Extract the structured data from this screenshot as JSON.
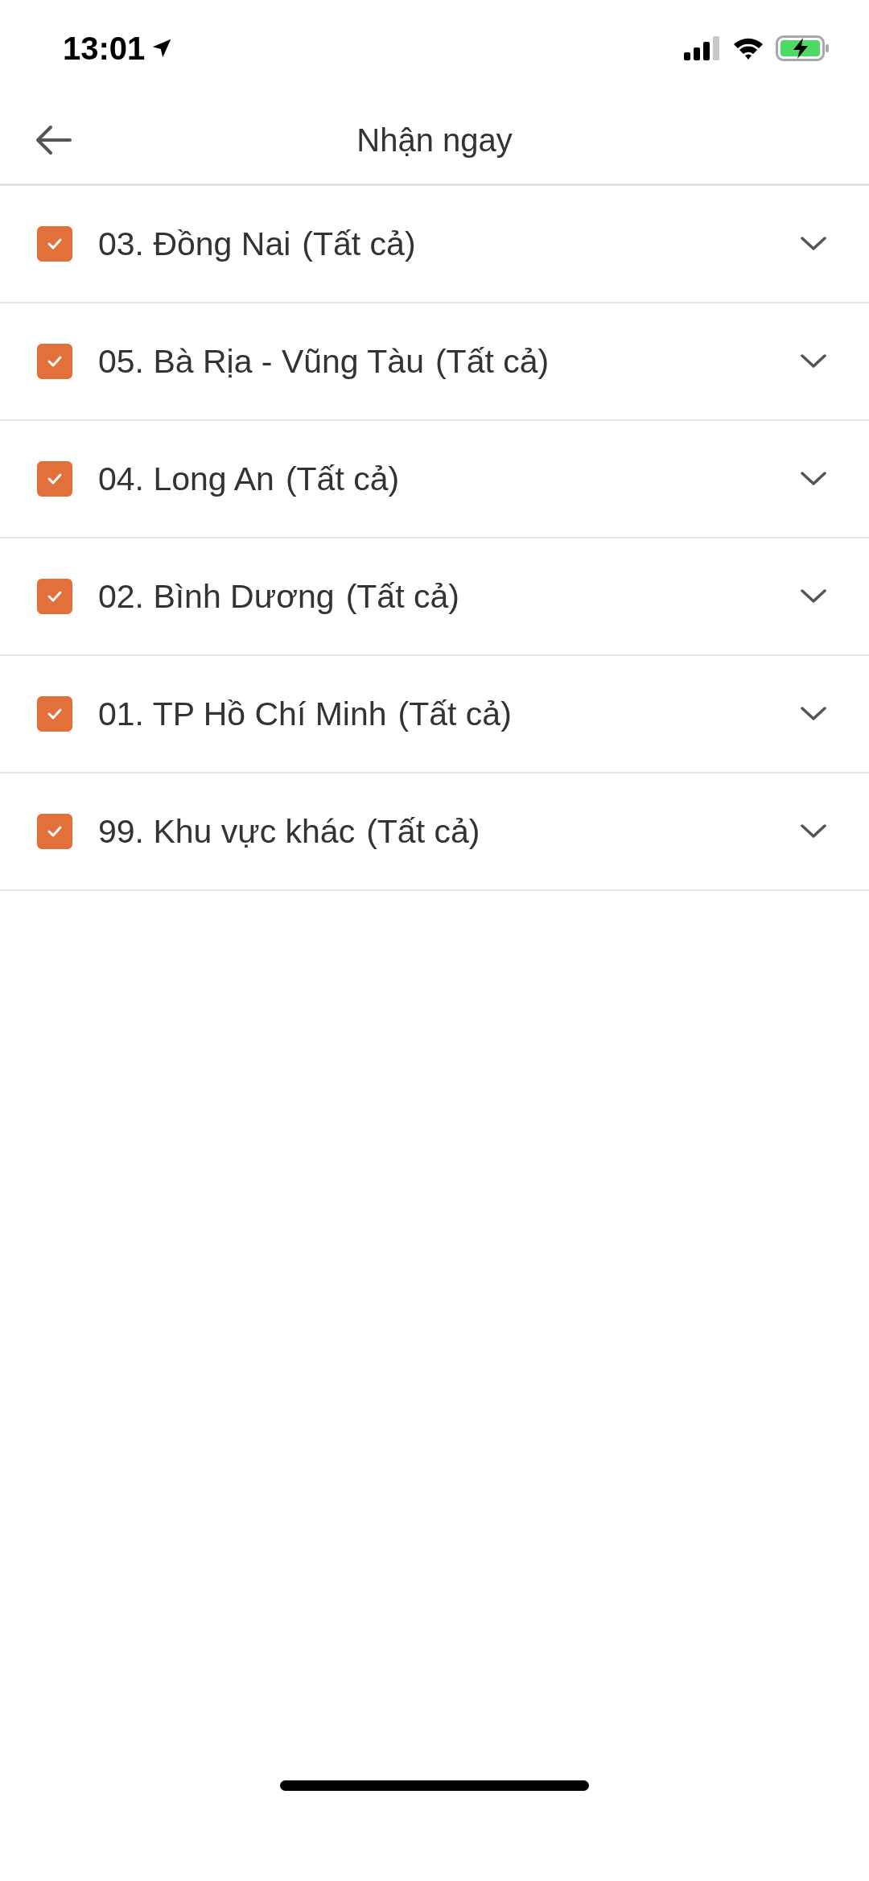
{
  "status_bar": {
    "time": "13:01"
  },
  "header": {
    "title": "Nhận ngay"
  },
  "regions": [
    {
      "name": "03. Đồng Nai",
      "scope": "(Tất cả)",
      "checked": true,
      "expanded": false
    },
    {
      "name": "05. Bà Rịa - Vũng Tàu",
      "scope": "(Tất cả)",
      "checked": true,
      "expanded": false
    },
    {
      "name": "04. Long An",
      "scope": "(Tất cả)",
      "checked": true,
      "expanded": false
    },
    {
      "name": "02. Bình Dương",
      "scope": "(Tất cả)",
      "checked": true,
      "expanded": false
    },
    {
      "name": "01. TP Hồ Chí Minh",
      "scope": "(Tất cả)",
      "checked": true,
      "expanded": false
    },
    {
      "name": "99. Khu vực khác",
      "scope": "(Tất cả)",
      "checked": true,
      "expanded": false
    }
  ]
}
